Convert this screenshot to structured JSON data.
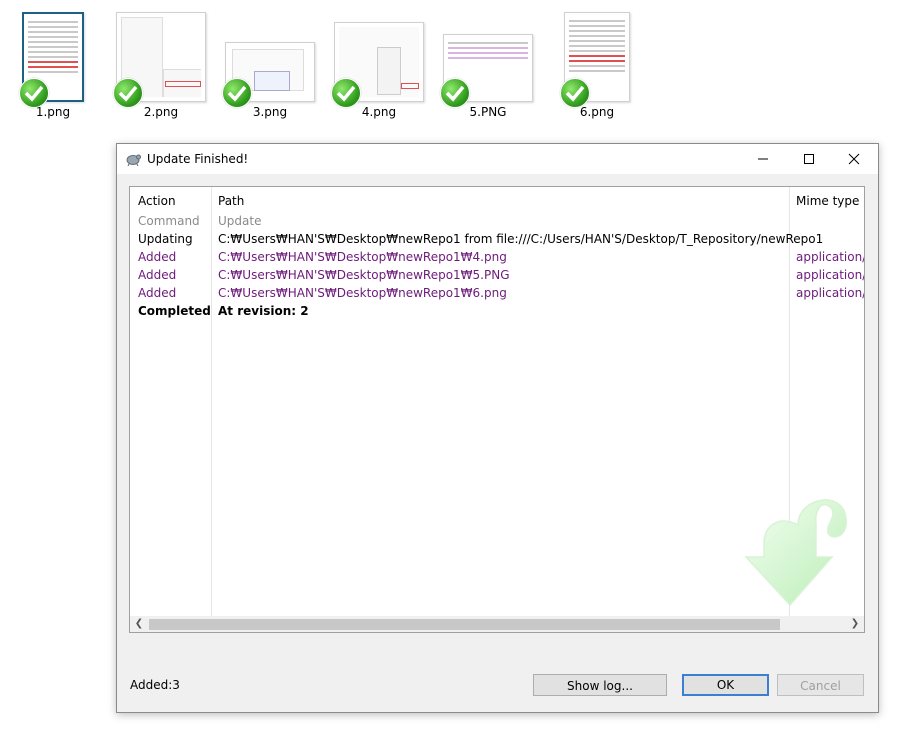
{
  "desktop": {
    "files": [
      {
        "name": "1.png"
      },
      {
        "name": "2.png"
      },
      {
        "name": "3.png"
      },
      {
        "name": "4.png"
      },
      {
        "name": "5.PNG"
      },
      {
        "name": "6.png"
      }
    ]
  },
  "dialog": {
    "title": "Update Finished!",
    "columns": [
      "Action",
      "Path",
      "Mime type"
    ],
    "rows": [
      {
        "action": "Command",
        "path": "Update",
        "mime": "",
        "style": "gray"
      },
      {
        "action": "Updating",
        "path": "C:₩Users₩HAN'S₩Desktop₩newRepo1 from file:///C:/Users/HAN'S/Desktop/T_Repository/newRepo1",
        "mime": "",
        "style": "black"
      },
      {
        "action": "Added",
        "path": "C:₩Users₩HAN'S₩Desktop₩newRepo1₩4.png",
        "mime": "application/c",
        "style": "purple"
      },
      {
        "action": "Added",
        "path": "C:₩Users₩HAN'S₩Desktop₩newRepo1₩5.PNG",
        "mime": "application/c",
        "style": "purple"
      },
      {
        "action": "Added",
        "path": "C:₩Users₩HAN'S₩Desktop₩newRepo1₩6.png",
        "mime": "application/c",
        "style": "purple"
      },
      {
        "action": "Completed",
        "path": "At revision: 2",
        "mime": "",
        "style": "bold"
      }
    ],
    "status": "Added:3",
    "buttons": {
      "show_log": "Show log...",
      "ok": "OK",
      "cancel": "Cancel"
    },
    "window_icons": [
      "minimize-icon",
      "maximize-icon",
      "close-icon"
    ]
  },
  "colors": {
    "purple": "#6d1b7b",
    "gray": "#8a8a8a",
    "ok_border": "#3c7fd0"
  }
}
